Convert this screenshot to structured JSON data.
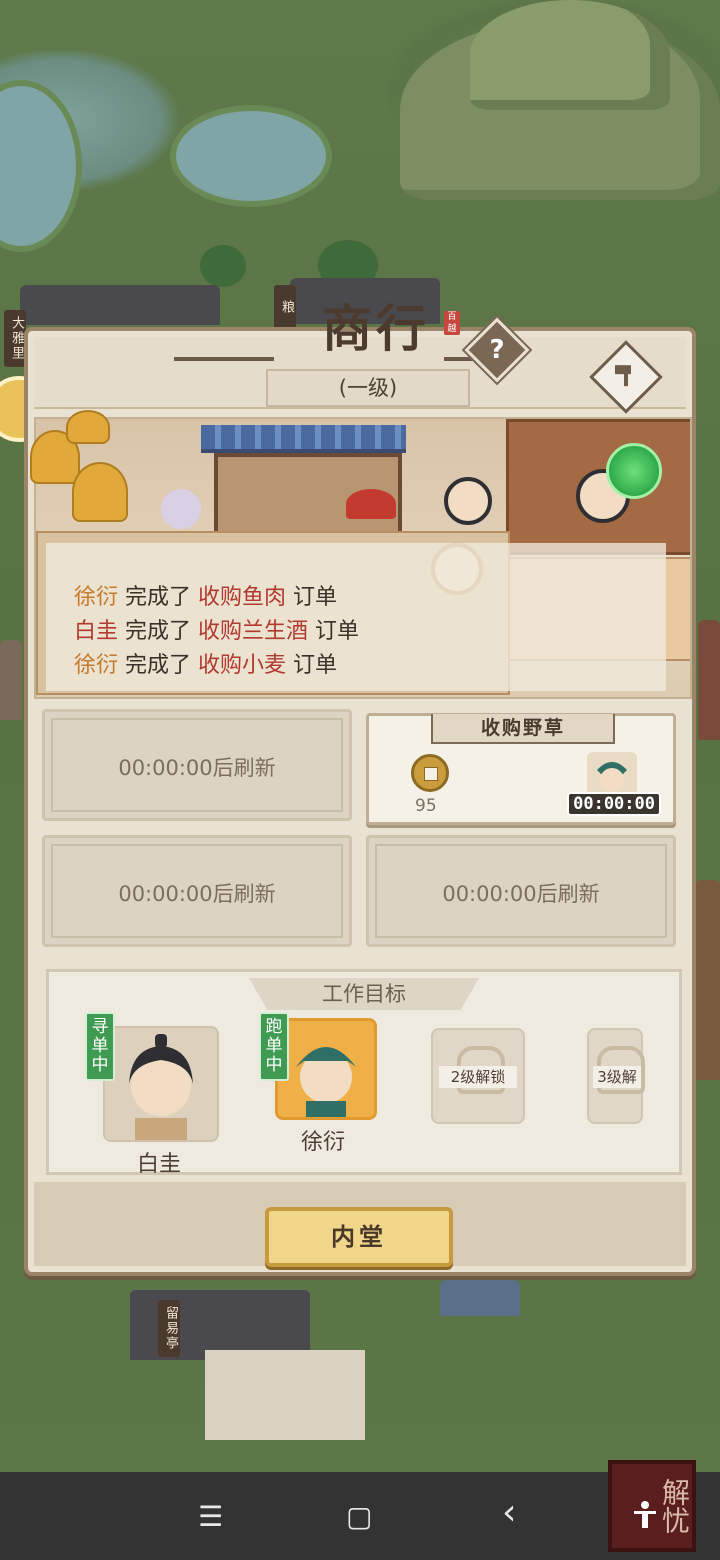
{
  "map": {
    "signs": [
      "大雅里",
      "粮",
      "留易亭"
    ],
    "bottom_right_badge": "解忧"
  },
  "dialog": {
    "title": "商行",
    "seal": "百越",
    "level": "(一级)",
    "log": [
      {
        "who": "徐衍",
        "verb": "完成了",
        "what": "收购鱼肉",
        "suffix": "订单"
      },
      {
        "who": "白圭",
        "verb": "完成了",
        "what": "收购兰生酒",
        "suffix": "订单"
      },
      {
        "who": "徐衍",
        "verb": "完成了",
        "what": "收购小麦",
        "suffix": "订单"
      }
    ],
    "slots": [
      {
        "label": "00:00:00后刷新"
      },
      {
        "title": "收购野草",
        "reward": "95",
        "timer": "00:00:00"
      },
      {
        "label": "00:00:00后刷新"
      },
      {
        "label": "00:00:00后刷新"
      }
    ],
    "goals": {
      "title": "工作目标",
      "workers": [
        {
          "name": "白圭",
          "status": "寻单中"
        },
        {
          "name": "徐衍",
          "status": "跑单中"
        }
      ],
      "locked": [
        {
          "label": "2级解锁"
        },
        {
          "label": "3级解"
        }
      ]
    },
    "inner_hall_button": "内堂"
  },
  "navbar": {
    "menu": "☰",
    "home": "▢",
    "back": "‹"
  }
}
